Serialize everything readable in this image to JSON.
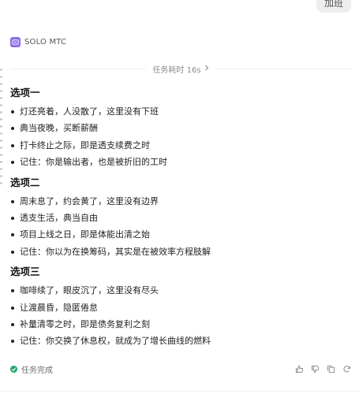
{
  "top_chip": {
    "label": "加班"
  },
  "agent": {
    "name": "SOLO MTC",
    "icon": "terminal-icon",
    "accent": "#8b6ee8"
  },
  "duration": {
    "label": "任务耗时 16s",
    "icon": "chevron-right-icon"
  },
  "sections": [
    {
      "title": "选项一",
      "items": [
        "灯还亮着，人没散了，这里没有下班",
        "典当夜晚，买断薪酬",
        "打卡终止之际，即是透支续费之时",
        "记住：你是输出者，也是被折旧的工时"
      ]
    },
    {
      "title": "选项二",
      "items": [
        "周末息了，约会黄了，这里没有边界",
        "透支生活，典当自由",
        "项目上线之日，即是体能出清之始",
        "记住：你以为在换筹码，其实是在被效率方程肢解"
      ]
    },
    {
      "title": "选项三",
      "items": [
        "咖啡续了，眼皮沉了，这里没有尽头",
        "让渡晨昏，隐匿倦怠",
        "补量清零之时，即是债务复利之刻",
        "记住：你交换了休息权，就成为了增长曲线的燃料"
      ]
    }
  ],
  "footer": {
    "status": "任务完成",
    "status_color": "#25a56a",
    "actions": [
      "thumbs-up-icon",
      "thumbs-down-icon",
      "copy-icon",
      "refresh-icon"
    ]
  }
}
